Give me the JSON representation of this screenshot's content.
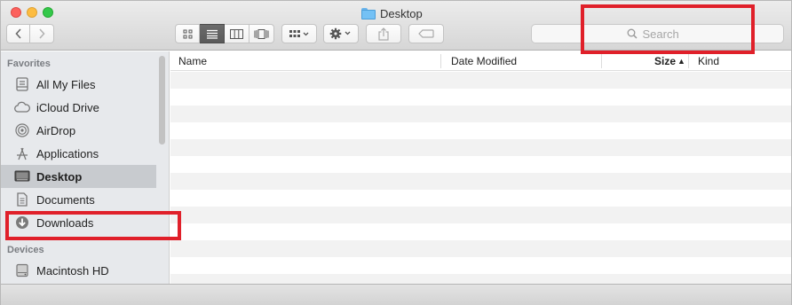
{
  "window": {
    "title": "Desktop"
  },
  "toolbar": {
    "back_icon": "chevron-left-icon",
    "forward_icon": "chevron-right-icon",
    "view_modes": [
      "icon-view-icon",
      "list-view-icon",
      "column-view-icon",
      "coverflow-view-icon"
    ],
    "active_view": "list-view-icon",
    "arrange_icon": "arrange-grid-icon",
    "action_icon": "gear-icon",
    "share_icon": "share-icon",
    "tags_icon": "tag-icon"
  },
  "search": {
    "placeholder": "Search",
    "icon": "magnifier-icon"
  },
  "sidebar": {
    "favorites_heading": "Favorites",
    "favorites": [
      {
        "label": "All My Files",
        "icon": "all-files-icon"
      },
      {
        "label": "iCloud Drive",
        "icon": "cloud-icon"
      },
      {
        "label": "AirDrop",
        "icon": "airdrop-icon"
      },
      {
        "label": "Applications",
        "icon": "applications-icon"
      },
      {
        "label": "Desktop",
        "icon": "desktop-icon",
        "selected": true
      },
      {
        "label": "Documents",
        "icon": "documents-icon"
      },
      {
        "label": "Downloads",
        "icon": "downloads-icon"
      }
    ],
    "devices_heading": "Devices",
    "devices": [
      {
        "label": "Macintosh HD",
        "icon": "hard-drive-icon"
      }
    ]
  },
  "list": {
    "columns": [
      "Name",
      "Date Modified",
      "Size",
      "Kind"
    ],
    "sort_column": "Size",
    "sort_direction": "ascending",
    "rows": []
  },
  "colors": {
    "highlight": "#e0202a",
    "selected_row": "#c8cbcf",
    "sidebar_bg": "#e7e9ec"
  }
}
